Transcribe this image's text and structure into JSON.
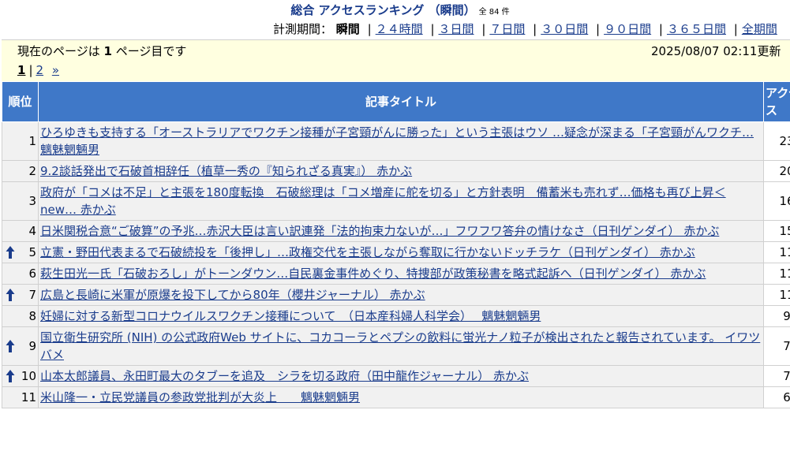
{
  "header": {
    "title": "総合 アクセスランキング （瞬間）",
    "count": "全 84 件"
  },
  "period": {
    "label": "計測期間：",
    "current": "瞬間",
    "links": [
      "２４時間",
      "３日間",
      "７日間",
      "３０日間",
      "９０日間",
      "３６５日間",
      "全期間"
    ]
  },
  "info": {
    "current_page_prefix": "現在のページは",
    "current_page_number": "1",
    "current_page_suffix": "ページ目です",
    "updated": "2025/08/07 02:11更新"
  },
  "pager": {
    "current": "1",
    "next_page": "2",
    "next": "»"
  },
  "table": {
    "headers": {
      "rank": "順位",
      "title": "記事タイトル",
      "access": "アクセス"
    },
    "rows": [
      {
        "rank": "1",
        "up": false,
        "title": "ひろゆきも支持する「オーストラリアでワクチン接種が子宮頸がんに勝った」という主張はウソ …疑念が深まる「子宮頸がんワクチ… 魑魅魍魎男",
        "access": "23"
      },
      {
        "rank": "2",
        "up": false,
        "title": "9.2談話発出で石破首相辞任（植草一秀の『知られざる真実』） 赤かぶ",
        "access": "20"
      },
      {
        "rank": "3",
        "up": false,
        "title": "政府が「コメは不足」と主張を180度転換　石破総理は「コメ増産に舵を切る」と方針表明　備蓄米も売れず…価格も再び上昇＜new… 赤かぶ",
        "access": "16"
      },
      {
        "rank": "4",
        "up": false,
        "title": "日米関税合意“ご破算”の予兆…赤沢大臣は言い訳連発「法的拘束力ないが…」フワフワ答弁の情けなさ（日刊ゲンダイ） 赤かぶ",
        "access": "15"
      },
      {
        "rank": "5",
        "up": true,
        "title": "立憲・野田代表まるで石破続投を「後押し」…政権交代を主張しながら奪取に行かないドッチラケ（日刊ゲンダイ） 赤かぶ",
        "access": "11"
      },
      {
        "rank": "6",
        "up": false,
        "title": "萩生田光一氏「石破おろし」がトーンダウン…自民裏金事件めぐり、特捜部が政策秘書を略式起訴へ（日刊ゲンダイ） 赤かぶ",
        "access": "11"
      },
      {
        "rank": "7",
        "up": true,
        "title": "広島と長崎に米軍が原爆を投下してから80年（櫻井ジャーナル） 赤かぶ",
        "access": "11"
      },
      {
        "rank": "8",
        "up": false,
        "title": "妊婦に対する新型コロナウイルスワクチン接種について　（日本産科婦人科学会）　 魑魅魍魎男",
        "access": "9"
      },
      {
        "rank": "9",
        "up": true,
        "title": "国立衛生研究所 (NIH) の公式政府Web サイトに、コカコーラとペプシの飲料に蛍光ナノ粒子が検出されたと報告されています。 イワツバメ",
        "access": "7"
      },
      {
        "rank": "10",
        "up": true,
        "title": "山本太郎議員、永田町最大のタブーを追及　シラを切る政府（田中龍作ジャーナル） 赤かぶ",
        "access": "7"
      },
      {
        "rank": "11",
        "up": false,
        "title": "米山隆一・立民党議員の参政党批判が大炎上　　魑魅魍魎男",
        "access": "6"
      }
    ]
  },
  "icons": {
    "rank_up": "arrow-up-icon"
  },
  "colors": {
    "header_bg": "#3f78c8",
    "link": "#1a3c8c",
    "info_bg": "#ffffe0",
    "row_bg": "#f1f1f1",
    "arrow": "#1a3c8c"
  }
}
